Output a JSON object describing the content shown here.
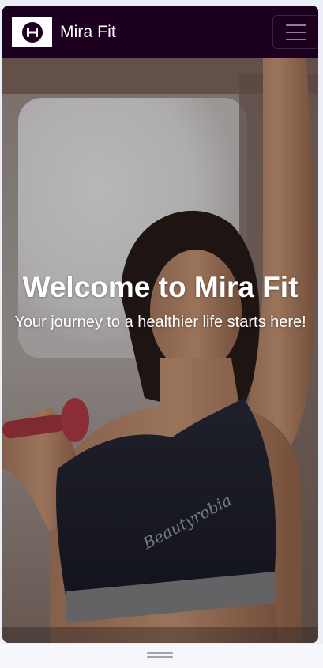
{
  "navbar": {
    "brand_name": "Mira Fit",
    "logo_icon": "dumbbell-icon",
    "menu_icon": "hamburger-icon"
  },
  "hero": {
    "title": "Welcome to Mira Fit",
    "subtitle": "Your journey to a healthier life starts here!"
  },
  "colors": {
    "navbar_bg": "#1d0020",
    "text": "#ffffff"
  }
}
